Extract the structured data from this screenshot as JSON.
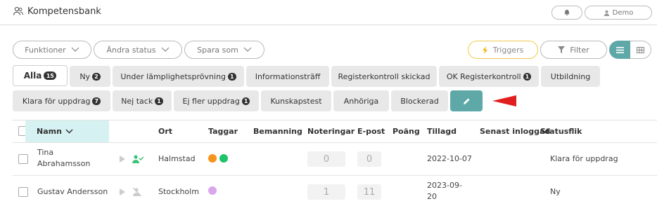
{
  "header": {
    "title": "Kompetensbank",
    "user": "Demo"
  },
  "toolbar": {
    "funktioner": "Funktioner",
    "andra_status": "Ändra status",
    "spara_som": "Spara som",
    "triggers": "Triggers",
    "filter": "Filter"
  },
  "tabs": [
    {
      "label": "Alla",
      "badge": "15"
    },
    {
      "label": "Ny",
      "badge": "2"
    },
    {
      "label": "Under lämplighetsprövning",
      "badge": "1"
    },
    {
      "label": "Informationsträff",
      "badge": ""
    },
    {
      "label": "Registerkontroll skickad",
      "badge": ""
    },
    {
      "label": "OK Registerkontroll",
      "badge": "1"
    },
    {
      "label": "Utbildning",
      "badge": ""
    },
    {
      "label": "Klara för uppdrag",
      "badge": "7"
    },
    {
      "label": "Nej tack",
      "badge": "1"
    },
    {
      "label": "Ej fler uppdrag",
      "badge": "1"
    },
    {
      "label": "Kunskapstest",
      "badge": ""
    },
    {
      "label": "Anhöriga",
      "badge": ""
    },
    {
      "label": "Blockerad",
      "badge": ""
    }
  ],
  "table": {
    "columns": {
      "namn": "Namn",
      "ort": "Ort",
      "taggar": "Taggar",
      "bemanning": "Bemanning",
      "noteringar": "Noteringar",
      "epost": "E-post",
      "poang": "Poäng",
      "tillagd": "Tillagd",
      "senast": "Senast inloggad",
      "statusflik": "Statusflik"
    },
    "rows": [
      {
        "name_line1": "Tina",
        "name_line2": "Abrahamsson",
        "ort": "Halmstad",
        "noteringar": "0",
        "epost": "0",
        "tillagd_line1": "2022-10-07",
        "tillagd_line2": "",
        "statusflik": "Klara för uppdrag",
        "tags": [
          "#f7941d",
          "#1ec36a"
        ]
      },
      {
        "name_line1": "Gustav Andersson",
        "name_line2": "",
        "ort": "Stockholm",
        "noteringar": "1",
        "epost": "11",
        "tillagd_line1": "2023-09-",
        "tillagd_line2": "20",
        "statusflik": "Ny",
        "tags": [
          "#d9a6ec"
        ]
      }
    ]
  },
  "colors": {
    "accent": "#5fa8a8",
    "header_highlight": "#d6f1f1",
    "arrow": "#e01e1e",
    "triggers_border": "#f2c94c"
  },
  "icons": [
    "users-icon",
    "bell-icon",
    "user-icon",
    "lightning-icon",
    "funnel-icon",
    "list-icon",
    "grid-icon",
    "pencil-icon",
    "play-icon",
    "user-check-icon",
    "user-off-icon",
    "chevron-down-icon"
  ]
}
